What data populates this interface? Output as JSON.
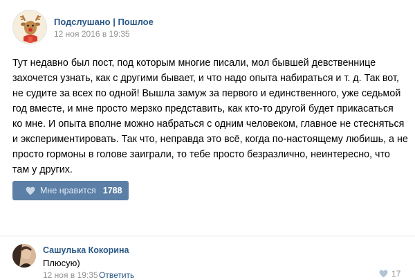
{
  "post": {
    "community_name": "Подслушано | Пошлое",
    "date": "12 ноя 2016 в 19:35",
    "text_lines": [
      "Тут недавно был пост, под которым многие писали, мол бывшей девственнице",
      "захочется узнать, как с другими бывает, и что надо опыта набираться и т. д. Так вот,",
      "не судите за всех по одной! Вышла замуж за первого и единственного, уже седьмой",
      "год вместе, и мне просто мерзко представить, как кто-то другой будет прикасаться",
      "ко мне. И опыта вполне можно набраться с одним человеком, главное не стесняться",
      "и экспериментировать. Так что, неправда это всё, когда по-настоящему любишь, а не",
      "просто гормоны в голове заиграли, то тебе просто безразлично, неинтересно, что",
      "там у других."
    ],
    "like_label": "Мне нравится",
    "like_count": "1788",
    "avatar_icon": "reindeer-avatar-icon",
    "like_icon": "heart-icon"
  },
  "comment": {
    "author": "Сашулька Кокорина",
    "text": "Плюсую)",
    "date": "12 ноя в 19:35",
    "reply_label": "Ответить",
    "like_count": "17",
    "like_icon": "heart-icon"
  },
  "colors": {
    "link": "#2a5885",
    "muted": "#939393",
    "like_button": "#5b7fa6",
    "divider": "#e7e8ec"
  }
}
